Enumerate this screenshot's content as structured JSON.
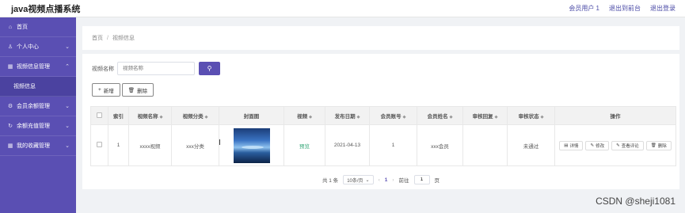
{
  "app": {
    "title": "java视频点播系统"
  },
  "topnav": {
    "user": "会员用户 1",
    "back_front": "退出到前台",
    "logout": "退出登录"
  },
  "sidebar": {
    "items": [
      {
        "label": "首页",
        "icon": "home-icon"
      },
      {
        "label": "个人中心",
        "icon": "user-icon"
      },
      {
        "label": "视频信息管理",
        "icon": "grid-icon"
      },
      {
        "label": "视频信息",
        "sub": true
      },
      {
        "label": "会员余额管理",
        "icon": "gear-icon"
      },
      {
        "label": "余额充值管理",
        "icon": "refresh-icon"
      },
      {
        "label": "我的收藏管理",
        "icon": "grid-icon"
      }
    ]
  },
  "breadcrumb": {
    "home": "首页",
    "sep": "/",
    "current": "视频信息"
  },
  "search": {
    "label": "视频名称",
    "placeholder": "视频名称"
  },
  "buttons": {
    "add": "新增",
    "delete": "删除"
  },
  "table": {
    "headers": [
      "索引",
      "视频名称",
      "视频分类",
      "封面图",
      "视频",
      "发布日期",
      "会员账号",
      "会员姓名",
      "审核回复",
      "审核状态",
      "操作"
    ],
    "rows": [
      {
        "index": "1",
        "name": "xxxx视频",
        "category": "xxx分类",
        "video": "预览",
        "date": "2021-04-13",
        "account": "1",
        "member_name": "xxx会员",
        "reply": "",
        "status": "未通过",
        "ops": {
          "detail": "详情",
          "edit": "修改",
          "comments": "查看评论",
          "delete": "删除"
        }
      }
    ]
  },
  "pager": {
    "total": "共 1 条",
    "page_size": "10条/页",
    "current": "1",
    "goto_label": "前往",
    "goto_value": "1",
    "page_unit": "页"
  },
  "watermark": "CSDN @sheji1081"
}
